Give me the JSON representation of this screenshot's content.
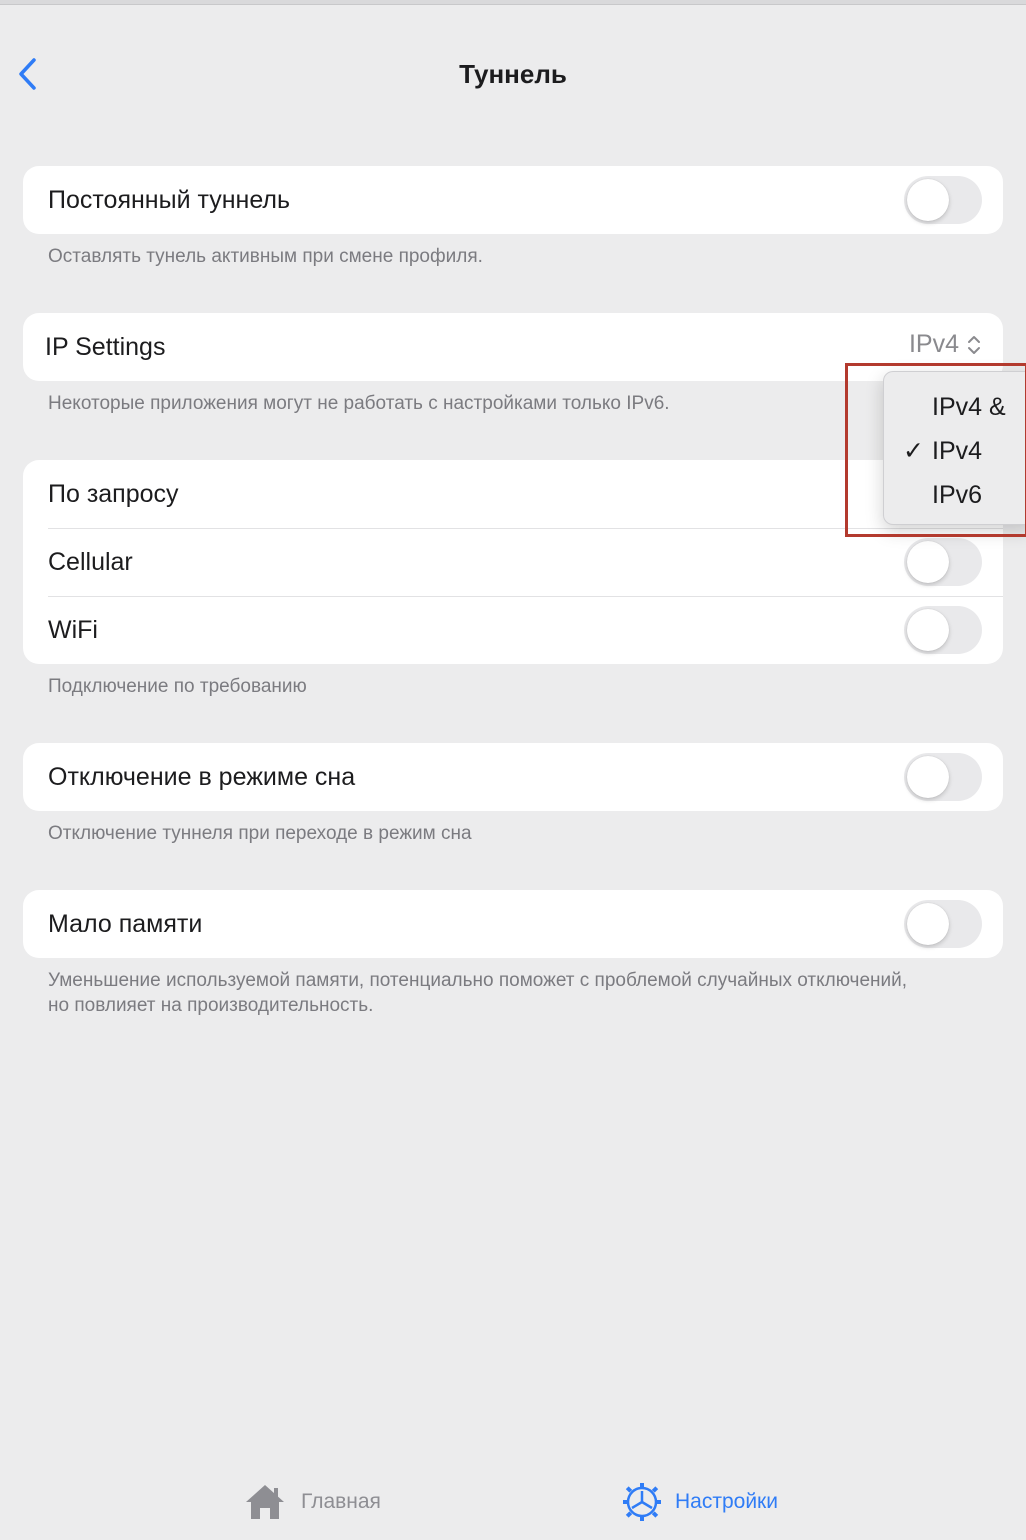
{
  "nav": {
    "title": "Туннель",
    "back_icon": "chevron-left-icon"
  },
  "colors": {
    "accent": "#2f7cf6",
    "background": "#ececed",
    "toggle_off": "#e9e9eb",
    "highlight": "#b33a2e"
  },
  "persistent_tunnel": {
    "label": "Постоянный туннель",
    "enabled": false,
    "note": "Оставлять тунель активным при смене профиля."
  },
  "ip_settings": {
    "label": "IP Settings",
    "value": "IPv4",
    "note": "Некоторые приложения могут не работать с настройками только IPv6.",
    "options": [
      {
        "label": "IPv4 &",
        "checked": false
      },
      {
        "label": "IPv4",
        "checked": true
      },
      {
        "label": "IPv6",
        "checked": false
      }
    ],
    "check_mark": "✓"
  },
  "on_demand": {
    "label": "По запросу",
    "cellular_label": "Cellular",
    "cellular_enabled": false,
    "wifi_label": "WiFi",
    "wifi_enabled": false,
    "note": "Подключение по требованию"
  },
  "sleep_disconnect": {
    "label": "Отключение в режиме сна",
    "enabled": false,
    "note": "Отключение туннеля при переходе в режим сна"
  },
  "low_memory": {
    "label": "Мало памяти",
    "enabled": false,
    "note": "Уменьшение используемой памяти, потенциально поможет с проблемой случайных отключений, но повлияет на производительность."
  },
  "tabs": [
    {
      "label": "Главная",
      "icon": "home-icon",
      "active": false
    },
    {
      "label": "Настройки",
      "icon": "gear-icon",
      "active": true
    }
  ]
}
